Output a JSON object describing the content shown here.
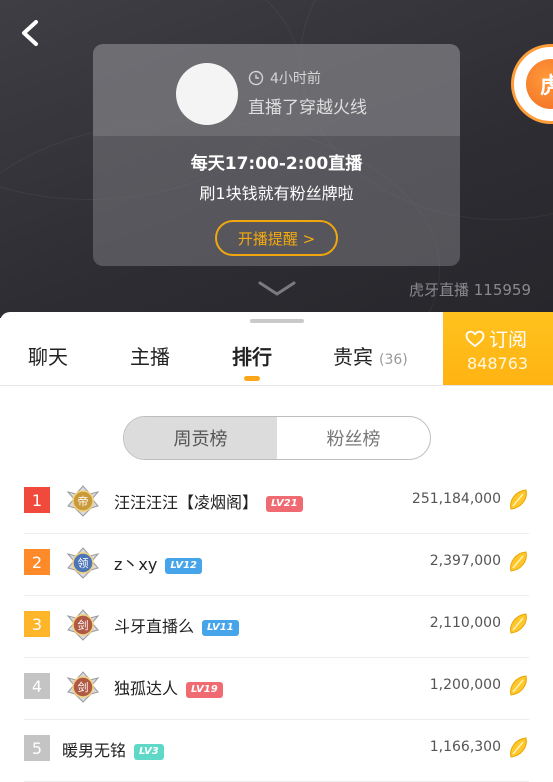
{
  "header": {
    "back_icon": "back-chevron-icon"
  },
  "live_card": {
    "time_ago": "4小时前",
    "last_live_title": "直播了穿越火线",
    "schedule": "每天17:00-2:00直播",
    "promo": "刷1块钱就有粉丝牌啦",
    "remind_button": "开播提醒 >"
  },
  "logo_char": "虎",
  "watermark": "虎牙直播 115959",
  "tabs": [
    {
      "label": "聊天"
    },
    {
      "label": "主播"
    },
    {
      "label": "排行",
      "active": true
    },
    {
      "label": "贵宾",
      "count": "(36)"
    }
  ],
  "subscribe": {
    "label": "订阅",
    "count": "848763"
  },
  "segment": {
    "weekly": "周贡榜",
    "fans": "粉丝榜",
    "active": "weekly"
  },
  "ranking": [
    {
      "rank": "1",
      "rank_color": "#f04a3c",
      "medal": "帝",
      "medal_color": "#c99a3a",
      "name": "汪汪汪汪【凌烟阁】",
      "level": "LV21",
      "level_color": "#f06a72",
      "score": "251,184,000"
    },
    {
      "rank": "2",
      "rank_color": "#ff8a2a",
      "medal": "领",
      "medal_color": "#4d76b8",
      "name": "z丶xy",
      "level": "LV12",
      "level_color": "#46a4ea",
      "score": "2,397,000"
    },
    {
      "rank": "3",
      "rank_color": "#ffb52a",
      "medal": "剑",
      "medal_color": "#b05a46",
      "name": "斗牙直播么",
      "level": "LV11",
      "level_color": "#46a4ea",
      "score": "2,110,000"
    },
    {
      "rank": "4",
      "rank_color": "#c4c4c4",
      "medal": "剑",
      "medal_color": "#b05a46",
      "name": "独孤达人",
      "level": "LV19",
      "level_color": "#f06a72",
      "score": "1,200,000"
    },
    {
      "rank": "5",
      "rank_color": "#c4c4c4",
      "medal": "",
      "medal_color": "",
      "name": "暖男无铭",
      "level": "LV3",
      "level_color": "#5fd8c8",
      "score": "1,166,300"
    }
  ]
}
